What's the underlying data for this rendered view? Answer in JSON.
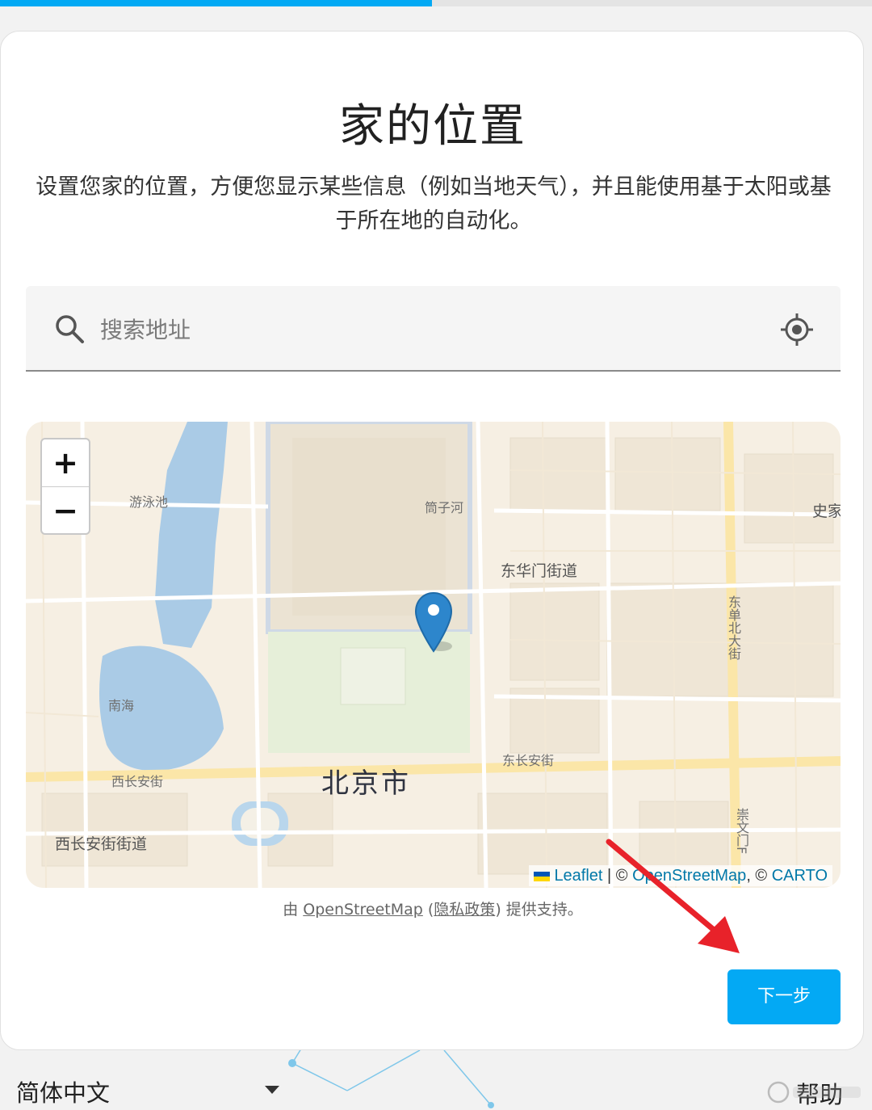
{
  "progress": {
    "fraction": 0.495,
    "color": "#03a9f4"
  },
  "card": {
    "title": "家的位置",
    "intro": "设置您家的位置，方便您显示某些信息（例如当地天气），并且能使用基于太阳或基于所在地的自动化。"
  },
  "search": {
    "placeholder": "搜索地址",
    "icon": "search-icon",
    "locate_icon": "my-location-icon"
  },
  "map": {
    "zoom_in": "+",
    "zoom_out": "−",
    "labels": {
      "youyongchi": "游泳池",
      "tongzihe": "筒子河",
      "donghuamen": "东华门街道",
      "nanhai": "南海",
      "xichangan": "西长安街",
      "dongchangan": "东长安街",
      "beijing": "北京市",
      "xichanganjiedao": "西长安街街道",
      "dongdanbeidajie": "东单北大街",
      "chongwenmen": "崇文门F",
      "shijia": "史家"
    },
    "attribution": {
      "leaflet": "Leaflet",
      "sep1": " | © ",
      "osm": "OpenStreetMap",
      "sep2": ", © ",
      "carto": "CARTO"
    }
  },
  "provider": {
    "prefix": "由 ",
    "osm": "OpenStreetMap",
    "open": " (",
    "privacy": "隐私政策",
    "close": ") 提供支持。"
  },
  "next_button": "下一步",
  "footer": {
    "language": "简体中文",
    "help": "帮助"
  },
  "colors": {
    "accent": "#03a9f4",
    "annotation_arrow": "#e8222a"
  }
}
